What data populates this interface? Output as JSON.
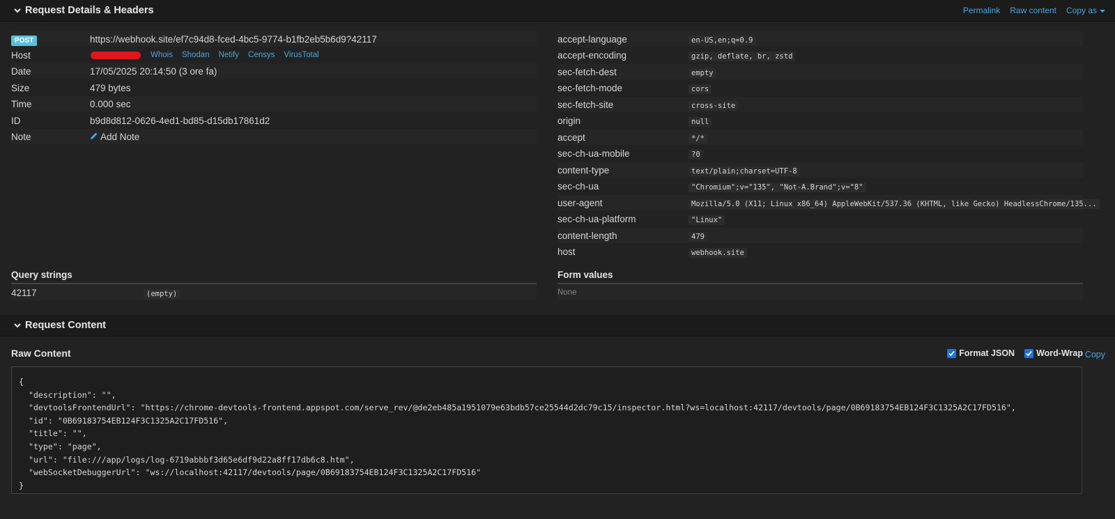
{
  "details_header": {
    "title": "Request Details & Headers",
    "links": {
      "permalink": "Permalink",
      "raw_content": "Raw content",
      "copy_as": "Copy as"
    }
  },
  "request": {
    "method": "POST",
    "url": "https://webhook.site/ef7c94d8-fced-4bc5-9774-b1fb2eb5b6d9?42117",
    "host_label": "Host",
    "host_tools": [
      "Whois",
      "Shodan",
      "Netify",
      "Censys",
      "VirusTotal"
    ],
    "date_label": "Date",
    "date": "17/05/2025 20:14:50 (3 ore fa)",
    "size_label": "Size",
    "size": "479 bytes",
    "time_label": "Time",
    "time": "0.000 sec",
    "id_label": "ID",
    "id": "b9d8d812-0626-4ed1-bd85-d15db17861d2",
    "note_label": "Note",
    "add_note": "Add Note"
  },
  "headers": [
    {
      "name": "accept-language",
      "value": "en-US,en;q=0.9"
    },
    {
      "name": "accept-encoding",
      "value": "gzip, deflate, br, zstd"
    },
    {
      "name": "sec-fetch-dest",
      "value": "empty"
    },
    {
      "name": "sec-fetch-mode",
      "value": "cors"
    },
    {
      "name": "sec-fetch-site",
      "value": "cross-site"
    },
    {
      "name": "origin",
      "value": "null"
    },
    {
      "name": "accept",
      "value": "*/*"
    },
    {
      "name": "sec-ch-ua-mobile",
      "value": "?0"
    },
    {
      "name": "content-type",
      "value": "text/plain;charset=UTF-8"
    },
    {
      "name": "sec-ch-ua",
      "value": "\"Chromium\";v=\"135\", \"Not-A.Brand\";v=\"8\""
    },
    {
      "name": "user-agent",
      "value": "Mozilla/5.0 (X11; Linux x86_64) AppleWebKit/537.36 (KHTML, like Gecko) HeadlessChrome/135..."
    },
    {
      "name": "sec-ch-ua-platform",
      "value": "\"Linux\""
    },
    {
      "name": "content-length",
      "value": "479"
    },
    {
      "name": "host",
      "value": "webhook.site"
    }
  ],
  "query_strings": {
    "title": "Query strings",
    "rows": [
      {
        "key": "42117",
        "value": "(empty)"
      }
    ]
  },
  "form_values": {
    "title": "Form values",
    "empty": "None"
  },
  "content_header": {
    "title": "Request Content"
  },
  "raw_content": {
    "title": "Raw Content",
    "format_json": "Format JSON",
    "word_wrap": "Word-Wrap",
    "copy": "Copy",
    "body": "{\n  \"description\": \"\",\n  \"devtoolsFrontendUrl\": \"https://chrome-devtools-frontend.appspot.com/serve_rev/@de2eb485a1951079e63bdb57ce25544d2dc79c15/inspector.html?ws=localhost:42117/devtools/page/0B69183754EB124F3C1325A2C17FD516\",\n  \"id\": \"0B69183754EB124F3C1325A2C17FD516\",\n  \"title\": \"\",\n  \"type\": \"page\",\n  \"url\": \"file:///app/logs/log-6719abbbf3d65e6df9d22a8ff17db6c8.htm\",\n  \"webSocketDebuggerUrl\": \"ws://localhost:42117/devtools/page/0B69183754EB124F3C1325A2C17FD516\"\n}"
  },
  "colors": {
    "link": "#4aa3df",
    "badge": "#5bc0de",
    "checkbox": "#1a73e8",
    "redaction": "#e0161a"
  }
}
